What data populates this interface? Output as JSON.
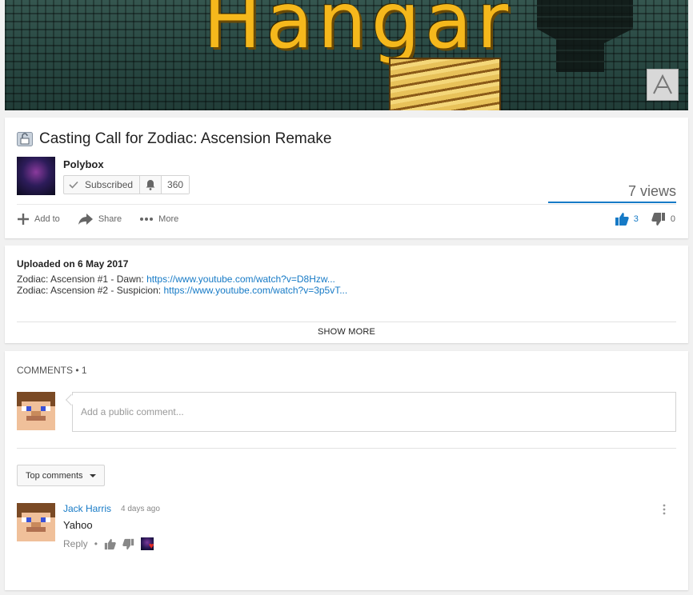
{
  "banner": {
    "title": "Hangar"
  },
  "video": {
    "title": "Casting Call for Zodiac: Ascension Remake",
    "channel": "Polybox",
    "subscribe_label": "Subscribed",
    "subscriber_count": "360",
    "views": "7 views",
    "actions": {
      "add_to": "Add to",
      "share": "Share",
      "more": "More"
    },
    "likes": "3",
    "dislikes": "0"
  },
  "description": {
    "uploaded": "Uploaded on 6 May 2017",
    "lines": [
      {
        "text": "Zodiac: Ascension #1 - Dawn: ",
        "link": "https://www.youtube.com/watch?v=D8Hzw..."
      },
      {
        "text": "Zodiac: Ascension #2 - Suspicion: ",
        "link": "https://www.youtube.com/watch?v=3p5vT..."
      }
    ],
    "show_more": "SHOW MORE"
  },
  "comments": {
    "header": "COMMENTS • 1",
    "placeholder": "Add a public comment...",
    "sort_label": "Top comments",
    "items": [
      {
        "author": "Jack Harris",
        "time": "4 days ago",
        "text": "Yahoo",
        "reply": "Reply"
      }
    ]
  },
  "colors": {
    "link": "#167ac6",
    "heart": "#e52d27"
  },
  "icons": [
    "lock-icon",
    "check-icon",
    "bell-icon",
    "plus-icon",
    "share-icon",
    "more-dots-icon",
    "thumbs-up-icon",
    "thumbs-down-icon",
    "caret-down-icon",
    "kebab-menu-icon",
    "heart-icon"
  ]
}
